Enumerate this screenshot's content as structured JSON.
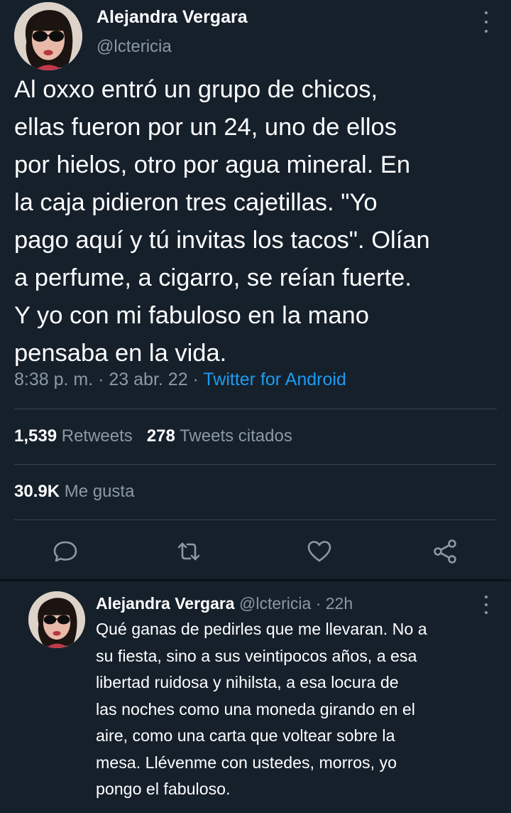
{
  "tweet": {
    "author_name": "Alejandra Vergara",
    "author_handle": "@lctericia",
    "text": "Al oxxo entró un grupo de chicos,\nellas fueron por un 24, uno de ellos\npor hielos, otro por agua mineral. En\nla caja pidieron tres cajetillas. \"Yo\npago aquí y tú invitas los tacos\". Olían\na perfume, a cigarro, se reían fuerte.\nY yo con mi fabuloso en la mano\npensaba en la vida.",
    "time": "8:38 p. m.",
    "sep1": " · ",
    "date": "23 abr. 22",
    "sep2": " · ",
    "source": "Twitter for Android"
  },
  "stats": {
    "retweets_count": "1,539",
    "retweets_label": "Retweets",
    "quotes_count": "278",
    "quotes_label": "Tweets citados",
    "likes_count": "30.9K",
    "likes_label": "Me gusta"
  },
  "actions": [
    "reply-icon",
    "retweet-icon",
    "like-icon",
    "share-icon"
  ],
  "reply": {
    "author_name": "Alejandra Vergara",
    "meta": " @lctericia · 22h",
    "text": "Qué ganas de pedirles que me llevaran. No a\nsu fiesta, sino a sus veintipocos años, a esa\nlibertad ruidosa y nihilsta, a esa locura de\nlas noches  como una moneda girando en el\naire, como una carta que voltear sobre la\nmesa. Llévenme con ustedes, morros, yo\npongo el fabuloso."
  },
  "colors": {
    "background": "#15202b",
    "text": "#ffffff",
    "secondary": "#8b98a5",
    "accent": "#1d9bf0",
    "divider": "#38444d"
  }
}
